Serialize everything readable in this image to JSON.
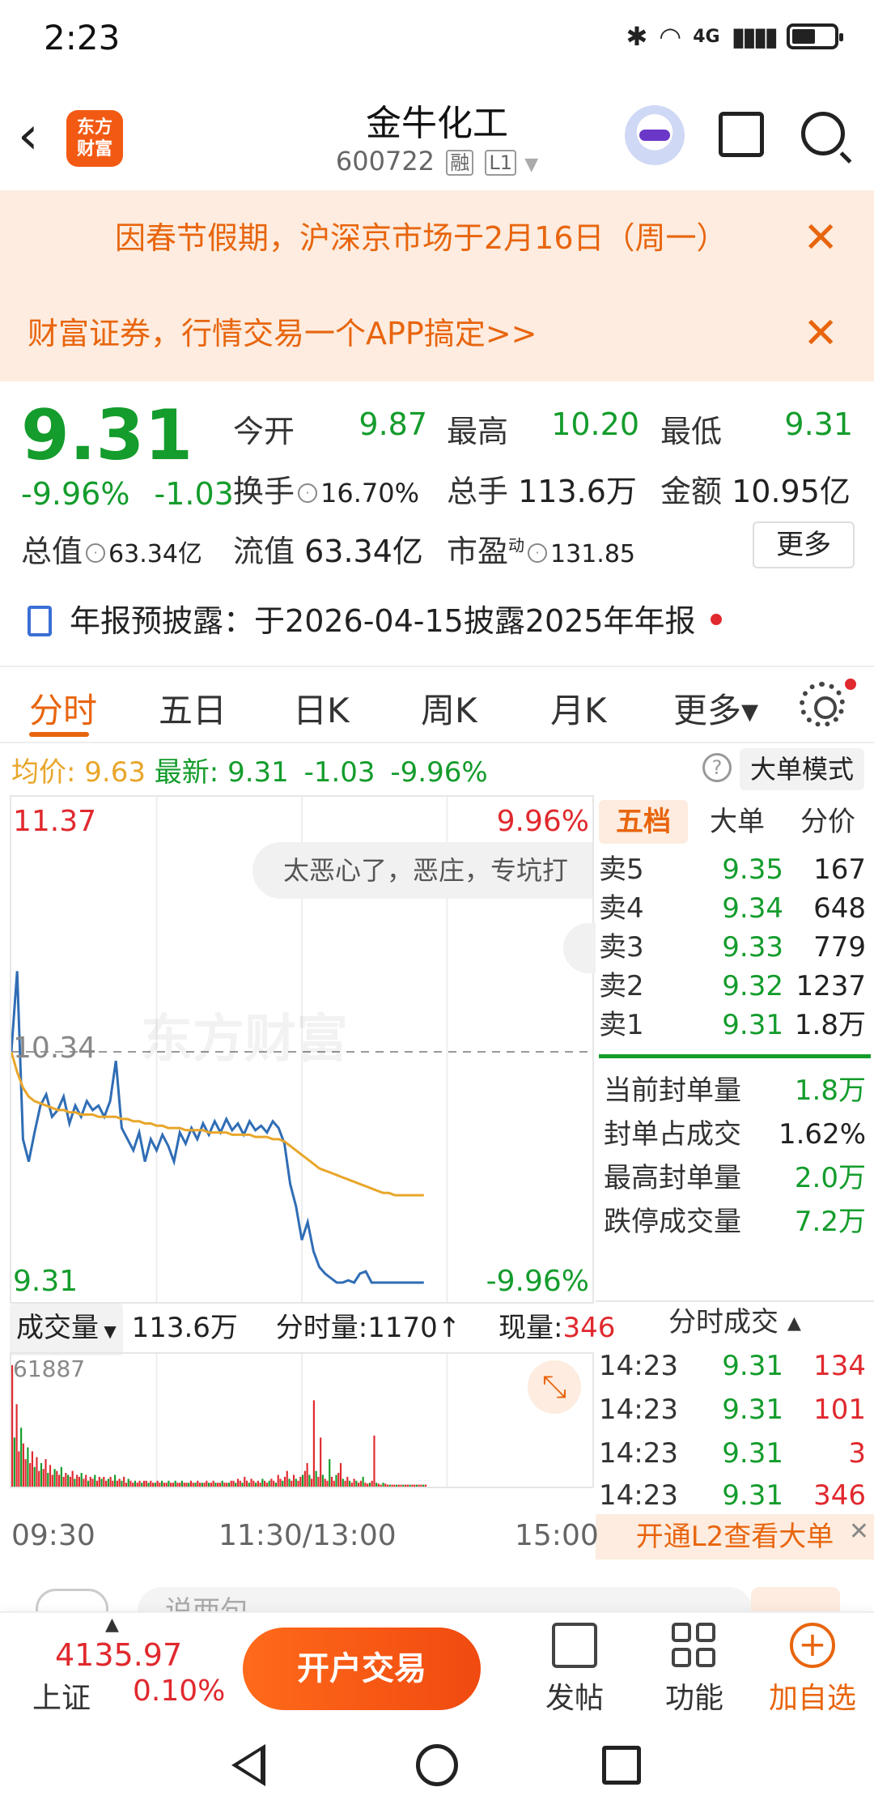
{
  "status_bar": {
    "time": "2:23",
    "network": "4G"
  },
  "header": {
    "back_label": "‹",
    "logo_text_1": "东方",
    "logo_text_2": "财富",
    "title": "金牛化工",
    "code": "600722",
    "tag_margin": "融",
    "tag_level": "L1"
  },
  "notices": [
    {
      "text": "因春节假期，沪深京市场于2月16日（周一）",
      "close": "✕"
    },
    {
      "text": "财富证券，行情交易一个APP搞定>>",
      "close": "✕"
    }
  ],
  "quote": {
    "price": "9.31",
    "change_pct": "-9.96%",
    "change_abs": "-1.03",
    "open_label": "今开",
    "open": "9.87",
    "high_label": "最高",
    "high": "10.20",
    "low_label": "最低",
    "low": "9.31",
    "turnover_label": "换手",
    "turnover": "16.70%",
    "volume_label": "总手",
    "volume": "113.6万",
    "amount_label": "金额",
    "amount": "10.95亿",
    "mktcap_label": "总值",
    "mktcap": "63.34亿",
    "float_label": "流值",
    "float_cap": "63.34亿",
    "pe_label": "市盈",
    "pe_sup": "动",
    "pe": "131.85",
    "more_button": "更多"
  },
  "annual_report": {
    "label": "年报预披露：",
    "text": "于2026-04-15披露2025年年报"
  },
  "tabs": [
    {
      "label": "分时",
      "active": true
    },
    {
      "label": "五日"
    },
    {
      "label": "日K"
    },
    {
      "label": "周K"
    },
    {
      "label": "月K"
    },
    {
      "label": "更多▾"
    }
  ],
  "summary_line": {
    "avg_label": "均价:",
    "avg": "9.63",
    "latest_label": "最新:",
    "latest": "9.31",
    "chg": "-1.03",
    "pct": "-9.96%",
    "help": "?",
    "bigorder_button": "大单模式"
  },
  "chart_data": {
    "type": "line",
    "ylim": [
      9.31,
      11.37
    ],
    "y_top_label": "11.37",
    "y_mid_label": "10.34",
    "y_bottom_label": "9.31",
    "pct_top_label": "9.96%",
    "pct_bottom_label": "-9.96%",
    "x_ticks": [
      "09:30",
      "11:30/13:00",
      "15:00"
    ],
    "watermark": "东方财富",
    "danmaku": "太恶心了，恶庄，专坑打",
    "series": [
      {
        "name": "最新",
        "color": "#2f6db5",
        "values": [
          10.34,
          10.7,
          9.95,
          9.85,
          9.98,
          10.1,
          10.15,
          10.05,
          10.08,
          10.14,
          10.02,
          10.1,
          10.05,
          10.12,
          10.08,
          10.1,
          10.05,
          10.12,
          10.3,
          10.0,
          9.95,
          9.9,
          9.98,
          9.85,
          9.95,
          9.9,
          9.97,
          9.92,
          9.85,
          9.98,
          9.93,
          10.0,
          9.95,
          10.02,
          9.97,
          10.03,
          9.98,
          10.04,
          9.99,
          10.02,
          9.97,
          10.03,
          9.99,
          10.01,
          9.98,
          10.03,
          10.0,
          9.93,
          9.75,
          9.65,
          9.5,
          9.58,
          9.45,
          9.38,
          9.35,
          9.33,
          9.31,
          9.31,
          9.32,
          9.31,
          9.35,
          9.36,
          9.31,
          9.31,
          9.31,
          9.31,
          9.31,
          9.31,
          9.31,
          9.31,
          9.31,
          9.31
        ]
      },
      {
        "name": "均价",
        "color": "#e8a62a",
        "values": [
          10.34,
          10.25,
          10.18,
          10.14,
          10.12,
          10.11,
          10.1,
          10.09,
          10.08,
          10.08,
          10.07,
          10.07,
          10.06,
          10.06,
          10.06,
          10.05,
          10.05,
          10.05,
          10.05,
          10.04,
          10.04,
          10.03,
          10.03,
          10.02,
          10.02,
          10.01,
          10.01,
          10.0,
          10.0,
          10.0,
          9.99,
          9.99,
          9.99,
          9.99,
          9.98,
          9.98,
          9.98,
          9.98,
          9.97,
          9.97,
          9.97,
          9.97,
          9.96,
          9.96,
          9.96,
          9.95,
          9.95,
          9.94,
          9.92,
          9.9,
          9.88,
          9.86,
          9.84,
          9.82,
          9.81,
          9.8,
          9.79,
          9.78,
          9.77,
          9.76,
          9.75,
          9.74,
          9.73,
          9.72,
          9.71,
          9.71,
          9.7,
          9.7,
          9.7,
          9.7,
          9.7,
          9.7
        ]
      }
    ],
    "volume": {
      "max_label": "61887",
      "values": [
        61887,
        25000,
        42000,
        18000,
        30000,
        22000,
        14000,
        20000,
        12000,
        18000,
        10000,
        15000,
        8000,
        12000,
        9000,
        14000,
        7000,
        11000,
        6000,
        9000,
        8000,
        6000,
        10000,
        5000,
        7000,
        6000,
        5000,
        8000,
        4000,
        6000,
        5000,
        7000,
        4000,
        6000,
        3000,
        5000,
        4000,
        6000,
        3000,
        5000,
        4000,
        5000,
        3000,
        4000,
        5000,
        3000,
        6000,
        3000,
        4000,
        3000,
        5000,
        2000,
        4000,
        3000,
        2000,
        3000,
        2000,
        3000,
        2000,
        3000,
        3000,
        2000,
        3000,
        2000,
        2000,
        3000,
        2000,
        3000,
        2000,
        2000,
        3000,
        2000,
        2000,
        3000,
        2000,
        2000,
        3000,
        2000,
        2000,
        2000,
        3000,
        2000,
        2000,
        3000,
        2000,
        2000,
        2000,
        3000,
        2000,
        2000,
        3000,
        2000,
        2000,
        2000,
        3000,
        2000,
        2000,
        2000,
        3000,
        3000,
        2000,
        4000,
        3000,
        2000,
        5000,
        3000,
        2000,
        4000,
        3000,
        2000,
        3000,
        2000,
        4000,
        3000,
        2000,
        3000,
        4000,
        3000,
        2000,
        6000,
        4000,
        3000,
        5000,
        8000,
        4000,
        3000,
        6000,
        4000,
        3000,
        5000,
        6000,
        8000,
        12000,
        6000,
        4000,
        44000,
        8000,
        5000,
        25000,
        6000,
        4000,
        3000,
        14000,
        5000,
        3000,
        6000,
        7000,
        12000,
        4000,
        3000,
        5000,
        3000,
        2000,
        4000,
        3000,
        2000,
        3000,
        5000,
        2000,
        1500,
        2000,
        3000,
        26000,
        2000,
        1500,
        1000,
        2000,
        1500,
        1000,
        1000,
        1000,
        1000,
        1000,
        1000,
        1000,
        1000,
        1000,
        1000,
        1000,
        1000,
        1000,
        1000,
        1000,
        1000,
        1000,
        1000
      ]
    }
  },
  "order_book": {
    "tabs": [
      "五档",
      "大单",
      "分价"
    ],
    "asks": [
      {
        "label": "卖5",
        "price": "9.35",
        "qty": "167"
      },
      {
        "label": "卖4",
        "price": "9.34",
        "qty": "648"
      },
      {
        "label": "卖3",
        "price": "9.33",
        "qty": "779"
      },
      {
        "label": "卖2",
        "price": "9.32",
        "qty": "1237"
      },
      {
        "label": "卖1",
        "price": "9.31",
        "qty": "1.8万"
      }
    ],
    "seal": [
      {
        "label": "当前封单量",
        "value": "1.8万",
        "green": true
      },
      {
        "label": "封单占成交",
        "value": "1.62%",
        "green": false
      },
      {
        "label": "最高封单量",
        "value": "2.0万",
        "green": true
      },
      {
        "label": "跌停成交量",
        "value": "7.2万",
        "green": true
      }
    ],
    "trades_title": "分时成交 ▴",
    "trades": [
      {
        "time": "14:23",
        "price": "9.31",
        "qty": "134"
      },
      {
        "time": "14:23",
        "price": "9.31",
        "qty": "101"
      },
      {
        "time": "14:23",
        "price": "9.31",
        "qty": "3"
      },
      {
        "time": "14:23",
        "price": "9.31",
        "qty": "346"
      }
    ],
    "l2_banner": "开通L2查看大单"
  },
  "volume_bar": {
    "select": "成交量",
    "total": "113.6万",
    "minute_label": "分时量:",
    "minute_value": "1170↑",
    "now_label": "现量:",
    "now_value": "346"
  },
  "comment": {
    "placeholder": "说两句…"
  },
  "bottom_bar": {
    "index_value": "4135.97",
    "index_name": "上证",
    "index_pct": "0.10%",
    "open_button": "开户交易",
    "post": "发帖",
    "func": "功能",
    "add": "加自选"
  }
}
